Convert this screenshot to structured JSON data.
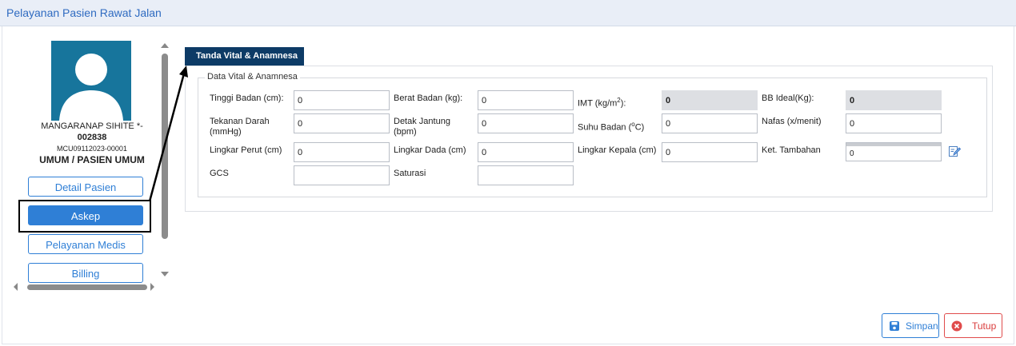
{
  "window": {
    "title": "Pelayanan Pasien Rawat Jalan"
  },
  "patient": {
    "name": "MANGARANAP SIHITE *-",
    "id": "002838",
    "mcu": "MCU09112023-00001",
    "type": "UMUM / PASIEN UMUM"
  },
  "sidebar": {
    "buttons": [
      {
        "label": "Detail Pasien"
      },
      {
        "label": "Askep",
        "active": true
      },
      {
        "label": "Pelayanan Medis"
      },
      {
        "label": "Billing"
      }
    ]
  },
  "tabs": [
    {
      "label": "Tanda Vital & Anamnesa"
    }
  ],
  "section": {
    "legend": "Data Vital & Anamnesa"
  },
  "fields": {
    "tinggi_badan": {
      "label": "Tinggi Badan (cm):",
      "value": "0"
    },
    "berat_badan": {
      "label": "Berat Badan (kg):",
      "value": "0"
    },
    "imt": {
      "label": "IMT (kg/m",
      "sup": "2",
      "suffix": "):",
      "value": "0"
    },
    "bb_ideal": {
      "label": "BB Ideal(Kg):",
      "value": "0"
    },
    "tekanan_darah": {
      "label_line1": "Tekanan Darah",
      "label_line2": "(mmHg)",
      "value": "0"
    },
    "detak_jantung": {
      "label_line1": "Detak Jantung",
      "label_line2": "(bpm)",
      "value": "0"
    },
    "suhu_badan": {
      "label": "Suhu Badan (",
      "sup": "o",
      "suffix": "C)",
      "value": "0"
    },
    "nafas": {
      "label": "Nafas (x/menit)",
      "value": "0"
    },
    "lingkar_perut": {
      "label": "Lingkar Perut (cm)",
      "value": "0"
    },
    "lingkar_dada": {
      "label": "Lingkar Dada (cm)",
      "value": "0"
    },
    "lingkar_kepala": {
      "label": "Lingkar Kepala (cm)",
      "value": "0"
    },
    "ket_tambahan": {
      "label": "Ket. Tambahan",
      "value": "0"
    },
    "gcs": {
      "label": "GCS",
      "value": ""
    },
    "saturasi": {
      "label": "Saturasi",
      "value": ""
    }
  },
  "footer": {
    "save_label": "Simpan",
    "close_label": "Tutup"
  },
  "colors": {
    "primary": "#2f7fd6",
    "tab_bg": "#0d3b66",
    "danger": "#e04b4b",
    "title": "#2f6bc1",
    "avatar_bg": "#17759c"
  }
}
